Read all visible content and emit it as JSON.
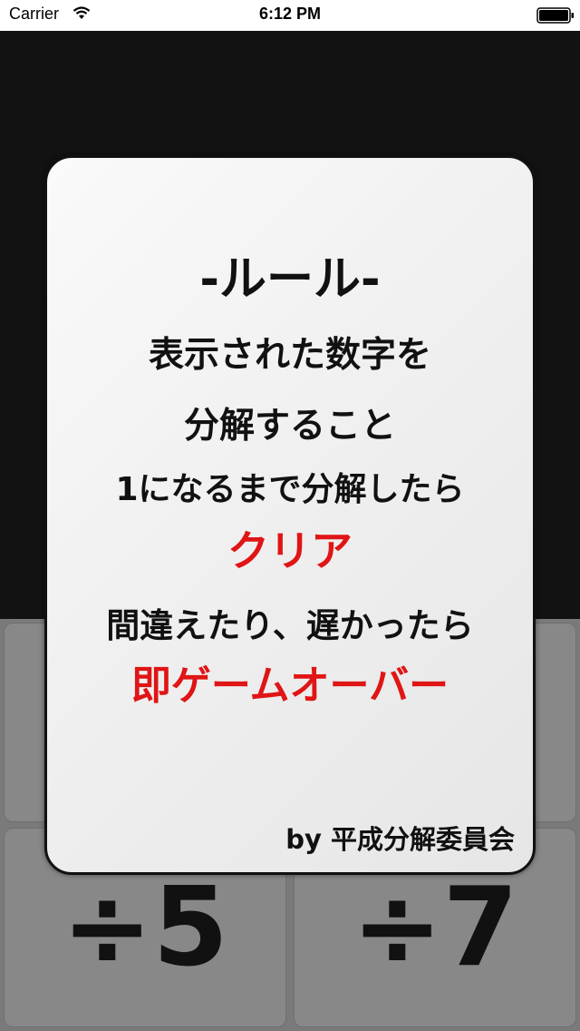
{
  "status_bar": {
    "carrier": "Carrier",
    "time": "6:12 PM",
    "wifi_icon": "wifi-icon",
    "battery_icon": "battery-icon"
  },
  "operation_pad": {
    "buttons": [
      {
        "label": "÷5"
      },
      {
        "label": "÷7"
      }
    ]
  },
  "rules": {
    "title": "-ルール-",
    "line1": "表示された数字を",
    "line2": "分解すること",
    "line3": "1になるまで分解したら",
    "clear": "クリア",
    "line4": "間違えたり、遅かったら",
    "gameover": "即ゲームオーバー",
    "credit": "by 平成分解委員会"
  },
  "colors": {
    "background": "#121212",
    "pad": "#7a7a7a",
    "accent_red": "#e01515",
    "card": "#f2f2f2"
  }
}
